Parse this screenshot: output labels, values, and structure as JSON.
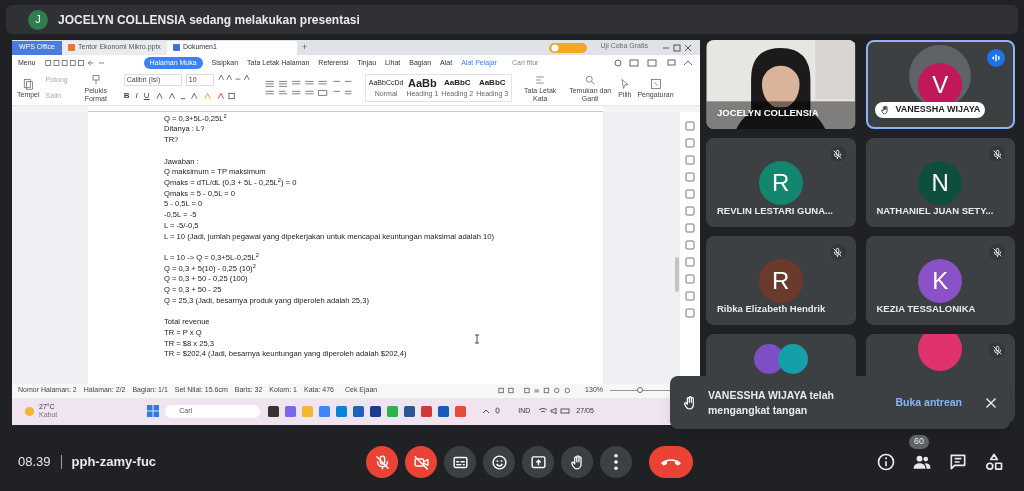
{
  "presentation_banner": {
    "avatar": "J",
    "text": "JOCELYN COLLENSIA sedang melakukan presentasi"
  },
  "shared_screen": {
    "app_tabs": [
      {
        "label": "WPS Office",
        "selected": false
      },
      {
        "label": "Tentor Ekonomi Mikro.pptx",
        "selected": false
      },
      {
        "label": "Dokumen1",
        "selected": true
      }
    ],
    "new_tab": "+",
    "trial_label": "Uji Coba Gratis",
    "menu": {
      "label": "Menu",
      "tabs": [
        {
          "label": "Halaman Muka",
          "selected": true
        },
        {
          "label": "Sisipkan",
          "selected": false
        },
        {
          "label": "Tata Letak Halaman",
          "selected": false
        },
        {
          "label": "Referensi",
          "selected": false
        },
        {
          "label": "Tinjau",
          "selected": false
        },
        {
          "label": "Lihat",
          "selected": false
        },
        {
          "label": "Bagian",
          "selected": false
        },
        {
          "label": "Alat",
          "selected": false
        },
        {
          "label": "Alat Pelajar",
          "selected": false
        }
      ],
      "search_placeholder": "Cari fitur"
    },
    "ribbon": {
      "paste": "Tempel",
      "cut": "Potong",
      "copy": "Salin",
      "format_painter": "Pelukis Format",
      "font": "Calibri (Isi)",
      "font_size": "10",
      "format_buttons": [
        "B",
        "I",
        "U"
      ],
      "styles": [
        {
          "preview": "AaBbCcDd",
          "label": "Normal"
        },
        {
          "preview": "AaBb",
          "label": "Heading 1"
        },
        {
          "preview": "AaBbC",
          "label": "Heading 2"
        },
        {
          "preview": "AaBbC",
          "label": "Heading 3"
        }
      ],
      "tools": [
        "Tata Letak Kata",
        "Temukan dan Ganti",
        "Pilih",
        "Pengaturan"
      ]
    },
    "document": {
      "paragraphs": [
        [
          "Q = 0,3+5L-0,25L$^{2}$",
          "Ditanya : L?",
          "TR?"
        ],
        [
          "Jawaban :",
          "Q maksimum = TP maksimum",
          "Qmaks = dTL/dL (0,3 + 5L - 0,25L$^{2}$) = 0",
          "Qmaks = 5 - 0,5L = 0",
          "5 - 0,5L = 0",
          "-0,5L = -5",
          "L = -5/-0,5",
          "L = 10 (Jadi, jumlah pegawai yang dipekerjakan untuk mencapai keuntungan maksimal adalah 10)"
        ],
        [
          "L = 10 -> Q =  0,3+5L-0,25L$^{2}$",
          "Q = 0,3 + 5(10) - 0,25 (10)$^{2}$",
          "Q = 0,3 + 50 - 0,25 (100)",
          "Q = 0,3 + 50 - 25",
          "Q = 25,3 (Jadi, besarnya produk yang diperoleh adalah 25,3)"
        ],
        [
          "Total revenue",
          "TR = P x Q",
          "TR = $8 x 25,3",
          "TR = $202,4 (Jadi, besarnya keuntungan yang diperoleh adalah $202,4)"
        ]
      ]
    },
    "status_bar": {
      "items": [
        "Nomor Halaman: 2",
        "Halaman: 2/2",
        "Bagian: 1/1",
        "Set Nilai: 15.6cm",
        "Baris: 32",
        "Kolom: 1",
        "Kata: 476"
      ],
      "spell_check": "Cek Ejaan",
      "zoom": "130%",
      "zoom_slider": {
        "level": 0.5
      }
    },
    "taskbar": {
      "temperature": "27°C",
      "weather": "Kabut",
      "search_placeholder": "Cari",
      "language": "IND",
      "clock": "27/05"
    }
  },
  "tiles": [
    {
      "kind": "video",
      "name": "JOCELYN COLLENSIA",
      "muted": false,
      "speaking": false,
      "hand_raised": false
    },
    {
      "kind": "avatar",
      "initial": "V",
      "color": "#c2185b",
      "name": "VANESSHA WIJAYA",
      "muted": false,
      "speaking": true,
      "hand_raised": true
    },
    {
      "kind": "avatar",
      "initial": "R",
      "color": "#12866f",
      "name": "REVLIN LESTARI GUNA...",
      "muted": true,
      "speaking": false,
      "hand_raised": false
    },
    {
      "kind": "avatar",
      "initial": "N",
      "color": "#0d4f3c",
      "name": "NATHANIEL JUAN SETY...",
      "muted": true,
      "speaking": false,
      "hand_raised": false
    },
    {
      "kind": "avatar",
      "initial": "R",
      "color": "#6b3a2c",
      "name": "Ribka Elizabeth Hendrik",
      "muted": true,
      "speaking": false,
      "hand_raised": false
    },
    {
      "kind": "avatar",
      "initial": "K",
      "color": "#8a52c6",
      "name": "KEZIA TESSALONIKA",
      "muted": true,
      "speaking": false,
      "hand_raised": false
    },
    {
      "kind": "group",
      "avatars": [
        {
          "color": "#7e4fc4"
        },
        {
          "color": "#13a0a8"
        }
      ],
      "muted": false,
      "speaking": false,
      "hand_raised": false
    },
    {
      "kind": "avatar",
      "color": "#e0336e",
      "muted": true,
      "speaking": false,
      "hand_raised": false
    }
  ],
  "toast": {
    "message": "VANESSHA WIJAYA telah mengangkat tangan",
    "action": "Buka antrean"
  },
  "meeting_bar": {
    "time": "08.39",
    "code": "pph-zamy-fuc",
    "controls": [
      {
        "kind": "mic",
        "on": false
      },
      {
        "kind": "camera",
        "on": false
      },
      {
        "kind": "captions"
      },
      {
        "kind": "emoji"
      },
      {
        "kind": "present"
      },
      {
        "kind": "hand"
      },
      {
        "kind": "more"
      },
      {
        "kind": "leave"
      }
    ],
    "side_buttons": [
      {
        "kind": "info"
      },
      {
        "kind": "people",
        "badge": "60"
      },
      {
        "kind": "chat"
      },
      {
        "kind": "activities"
      }
    ]
  }
}
